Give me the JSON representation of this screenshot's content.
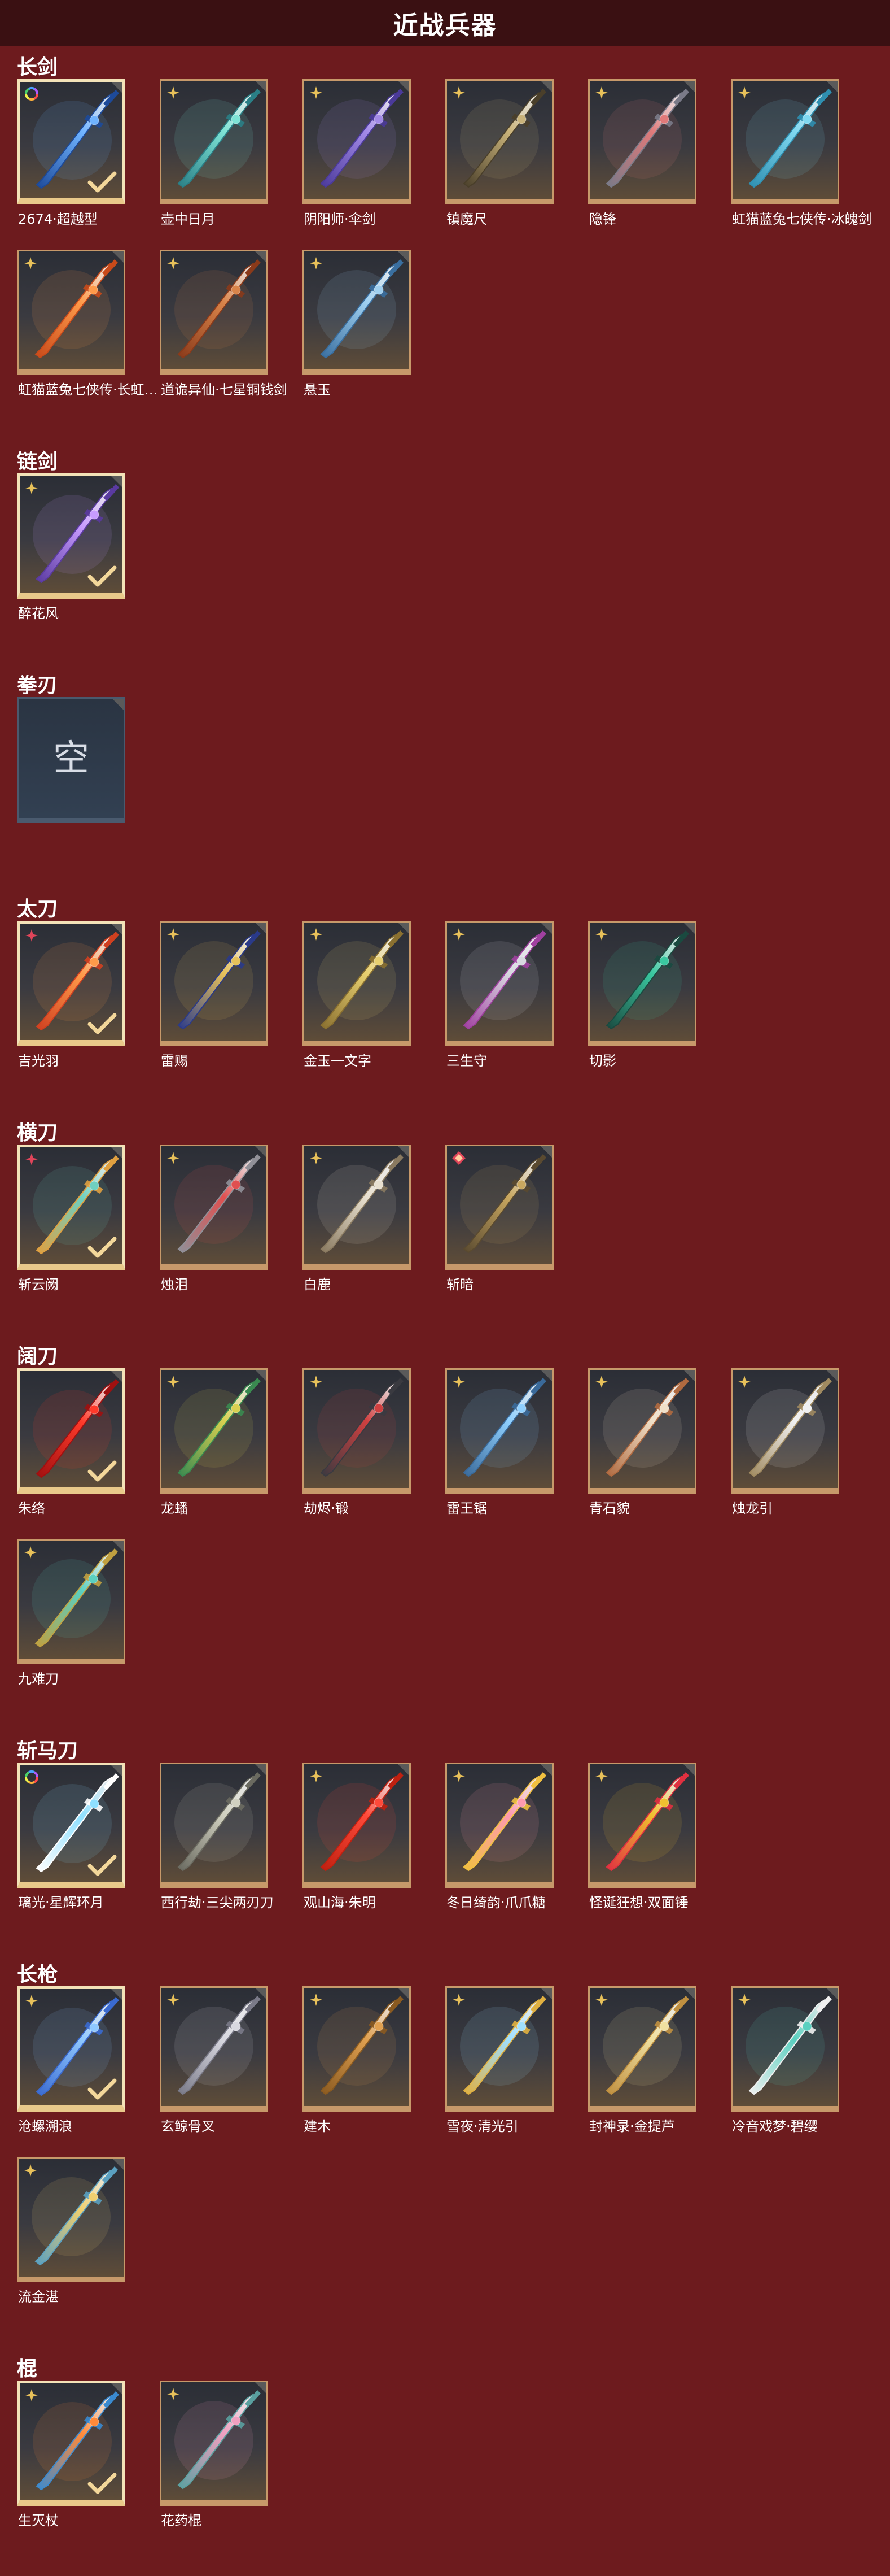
{
  "page_title": "近战兵器",
  "empty_label": "空",
  "colors": {
    "background": "#6d1b1e",
    "title_bar": "#3a1012",
    "card_border": "#c7996a",
    "card_selected_border": "#f3e2b8",
    "rank_gold": "#e8c15a",
    "rank_red": "#e0455a"
  },
  "sections": [
    {
      "title": "长剑",
      "items": [
        {
          "name": "2674·超越型",
          "badge": "rainbow-ring-icon",
          "selected": true,
          "colors": [
            "#6fb3ff",
            "#1d4a9a"
          ]
        },
        {
          "name": "壶中日月",
          "badge": "gold-star-icon",
          "selected": false,
          "colors": [
            "#7de3d5",
            "#2a7f86"
          ]
        },
        {
          "name": "阴阳师·伞剑",
          "badge": "gold-star-icon",
          "selected": false,
          "colors": [
            "#a38ae8",
            "#4b3a9a"
          ]
        },
        {
          "name": "镇魔尺",
          "badge": "gold-star-icon",
          "selected": false,
          "colors": [
            "#c9b37a",
            "#4a3f2a"
          ]
        },
        {
          "name": "隐锋",
          "badge": "gold-star-icon",
          "selected": false,
          "colors": [
            "#e07a7a",
            "#7a7a88"
          ]
        },
        {
          "name": "虹猫蓝兔七侠传·冰魄剑",
          "badge": "gold-star-icon",
          "selected": false,
          "colors": [
            "#7fd8f0",
            "#2f8fb0"
          ]
        },
        {
          "name": "虹猫蓝兔七侠传·长虹剑",
          "display": "虹猫蓝兔七侠传·长虹…",
          "badge": "gold-star-icon",
          "selected": false,
          "colors": [
            "#ff9a4a",
            "#c84a1a"
          ]
        },
        {
          "name": "道诡异仙·七星铜钱剑",
          "badge": "gold-star-icon",
          "selected": false,
          "colors": [
            "#d9844a",
            "#8a3a1a"
          ]
        },
        {
          "name": "悬玉",
          "badge": "gold-star-icon",
          "selected": false,
          "colors": [
            "#9fd0f0",
            "#3a6fa0"
          ]
        }
      ]
    },
    {
      "title": "链剑",
      "items": [
        {
          "name": "醉花风",
          "badge": "gold-star-icon",
          "selected": true,
          "colors": [
            "#c79bff",
            "#5a3aa0"
          ]
        }
      ]
    },
    {
      "title": "拳刃",
      "items": [
        {
          "name": "",
          "empty": true
        }
      ]
    },
    {
      "title": "太刀",
      "items": [
        {
          "name": "吉光羽",
          "badge": "red-star-icon",
          "selected": true,
          "colors": [
            "#ff9a4a",
            "#d04020"
          ]
        },
        {
          "name": "雷赐",
          "badge": "gold-star-icon",
          "selected": false,
          "colors": [
            "#e6c15a",
            "#2a3a8a"
          ]
        },
        {
          "name": "金玉一文字",
          "badge": "gold-star-icon",
          "selected": false,
          "colors": [
            "#e8d070",
            "#8a7030"
          ]
        },
        {
          "name": "三生守",
          "badge": "gold-star-icon",
          "selected": false,
          "colors": [
            "#d8d8e0",
            "#a040a0"
          ]
        },
        {
          "name": "切影",
          "badge": "gold-star-icon",
          "selected": false,
          "colors": [
            "#3ac8a0",
            "#1a4a40"
          ]
        }
      ]
    },
    {
      "title": "横刀",
      "items": [
        {
          "name": "斩云阙",
          "badge": "red-star-icon",
          "selected": true,
          "colors": [
            "#6fd0c0",
            "#e0a040"
          ]
        },
        {
          "name": "烛泪",
          "badge": "gold-star-icon",
          "selected": false,
          "colors": [
            "#e05050",
            "#909098"
          ]
        },
        {
          "name": "白鹿",
          "badge": "gold-star-icon",
          "selected": false,
          "colors": [
            "#e8e0d0",
            "#8a7a60"
          ]
        },
        {
          "name": "斩暗",
          "badge": "red-diamond-icon",
          "selected": false,
          "colors": [
            "#c9a860",
            "#5a4a30"
          ]
        }
      ]
    },
    {
      "title": "阔刀",
      "items": [
        {
          "name": "朱络",
          "badge": "",
          "selected": true,
          "colors": [
            "#ff3a2a",
            "#a01010"
          ]
        },
        {
          "name": "龙蟠",
          "badge": "gold-star-icon",
          "selected": false,
          "colors": [
            "#d8d050",
            "#3a8a50"
          ]
        },
        {
          "name": "劫烬·锻",
          "badge": "gold-star-icon",
          "selected": false,
          "colors": [
            "#d04040",
            "#3a3a40"
          ]
        },
        {
          "name": "雷王锯",
          "badge": "gold-star-icon",
          "selected": false,
          "colors": [
            "#8fd0ff",
            "#3a6a9a"
          ]
        },
        {
          "name": "青石貌",
          "badge": "gold-star-icon",
          "selected": false,
          "colors": [
            "#f0e0c8",
            "#b06a40"
          ]
        },
        {
          "name": "烛龙引",
          "badge": "gold-star-icon",
          "selected": false,
          "colors": [
            "#f0f0f0",
            "#a08a60"
          ]
        },
        {
          "name": "九难刀",
          "badge": "gold-star-icon",
          "selected": false,
          "colors": [
            "#5ad0c0",
            "#c0a040"
          ]
        }
      ]
    },
    {
      "title": "斩马刀",
      "items": [
        {
          "name": "璃光·星辉环月",
          "badge": "rainbow-ring-icon",
          "selected": true,
          "colors": [
            "#8fe0ff",
            "#ffffff"
          ]
        },
        {
          "name": "西行劫·三尖两刃刀",
          "badge": "",
          "selected": false,
          "colors": [
            "#d0d0c0",
            "#6a6a60"
          ]
        },
        {
          "name": "观山海·朱明",
          "badge": "gold-star-icon",
          "selected": false,
          "colors": [
            "#ff4a3a",
            "#c02010"
          ]
        },
        {
          "name": "冬日绮韵·爪爪糖",
          "badge": "gold-star-icon",
          "selected": false,
          "colors": [
            "#ff9ab0",
            "#f0c040"
          ]
        },
        {
          "name": "怪诞狂想·双面锤",
          "badge": "gold-star-icon",
          "selected": false,
          "colors": [
            "#f0c030",
            "#e03040"
          ]
        }
      ]
    },
    {
      "title": "长枪",
      "items": [
        {
          "name": "沧螺溯浪",
          "badge": "gold-star-icon",
          "selected": true,
          "colors": [
            "#8fc8ff",
            "#3a6ad0"
          ]
        },
        {
          "name": "玄鲸骨叉",
          "badge": "gold-star-icon",
          "selected": false,
          "colors": [
            "#d8d8e0",
            "#7a7a88"
          ]
        },
        {
          "name": "建木",
          "badge": "gold-star-icon",
          "selected": false,
          "colors": [
            "#e0a050",
            "#8a5a20"
          ]
        },
        {
          "name": "雪夜·清光引",
          "badge": "gold-star-icon",
          "selected": false,
          "colors": [
            "#a0e0ff",
            "#e0b040"
          ]
        },
        {
          "name": "封神录·金提芦",
          "badge": "gold-star-icon",
          "selected": false,
          "colors": [
            "#f0e0a0",
            "#c09040"
          ]
        },
        {
          "name": "冷音戏梦·碧缨",
          "badge": "gold-star-icon",
          "selected": false,
          "colors": [
            "#5ad0c0",
            "#f0f0f0"
          ]
        },
        {
          "name": "流金湛",
          "badge": "gold-star-icon",
          "selected": false,
          "colors": [
            "#f0d070",
            "#5aa0c0"
          ]
        }
      ]
    },
    {
      "title": "棍",
      "items": [
        {
          "name": "生灭杖",
          "badge": "gold-star-icon",
          "selected": true,
          "colors": [
            "#ff8a3a",
            "#3a8ad0"
          ]
        },
        {
          "name": "花药棍",
          "badge": "gold-star-icon",
          "selected": false,
          "colors": [
            "#f0a0c0",
            "#5aa0a0"
          ]
        }
      ]
    }
  ]
}
